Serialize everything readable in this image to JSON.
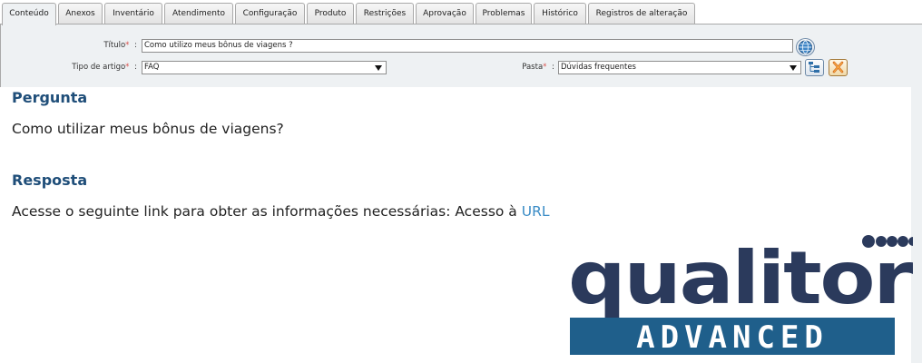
{
  "tabs": [
    {
      "label": "Conteúdo",
      "active": true
    },
    {
      "label": "Anexos",
      "active": false
    },
    {
      "label": "Inventário",
      "active": false
    },
    {
      "label": "Atendimento",
      "active": false
    },
    {
      "label": "Configuração",
      "active": false
    },
    {
      "label": "Produto",
      "active": false
    },
    {
      "label": "Restrições",
      "active": false
    },
    {
      "label": "Aprovação",
      "active": false
    },
    {
      "label": "Problemas",
      "active": false
    },
    {
      "label": "Histórico",
      "active": false
    },
    {
      "label": "Registros de alteração",
      "active": false
    }
  ],
  "form": {
    "titulo_label": "Título",
    "titulo_value": "Como utilizo meus bônus de viagens ?",
    "tipo_label": "Tipo de artigo",
    "tipo_value": "FAQ",
    "pasta_label": "Pasta",
    "pasta_value": "Dúvidas frequentes",
    "required_mark": "*",
    "separator": ":"
  },
  "article": {
    "pergunta_heading": "Pergunta",
    "pergunta_text": "Como utilizar meus bônus de viagens?",
    "resposta_heading": "Resposta",
    "resposta_text": "Acesse o seguinte link para obter as informações necessárias: Acesso à ",
    "resposta_link": "URL"
  },
  "logo": {
    "brand": "qualitor",
    "tagline": "ADVANCED",
    "primary_color": "#2b3a5c",
    "banner_color": "#1f5f8b"
  }
}
